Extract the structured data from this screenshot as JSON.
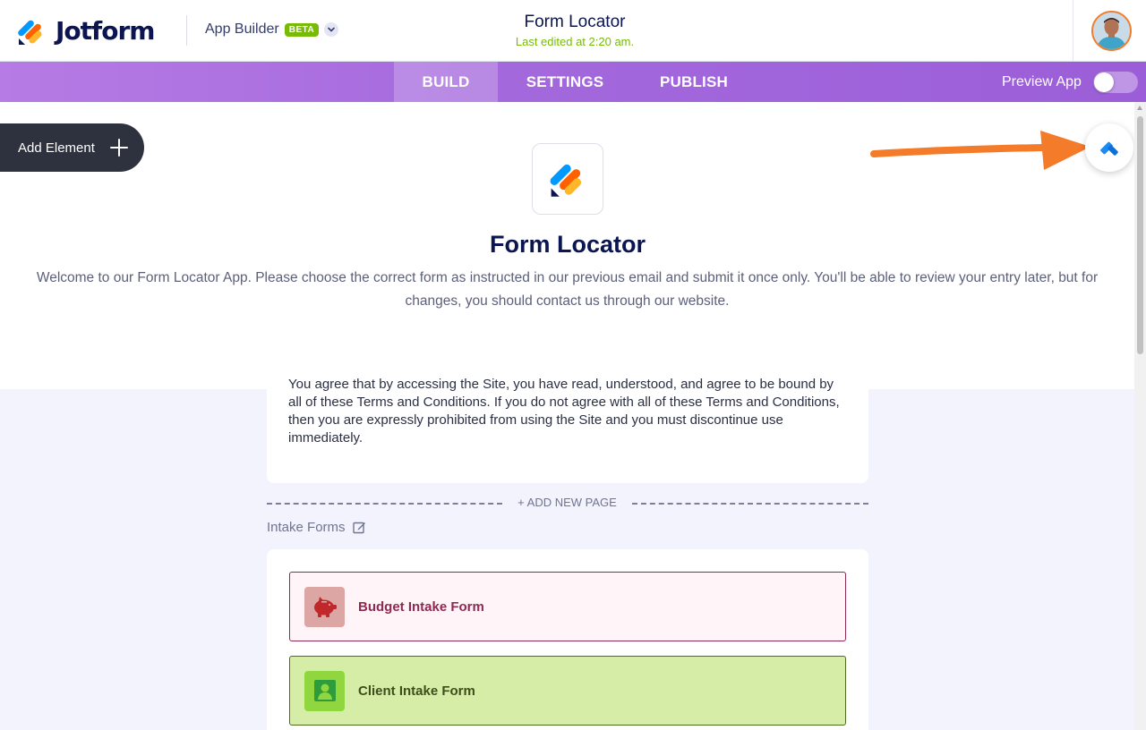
{
  "header": {
    "brand": "Jotform",
    "app_builder_label": "App Builder",
    "beta_badge": "BETA",
    "app_title": "Form Locator",
    "last_edited": "Last edited at 2:20 am."
  },
  "nav": {
    "tabs": [
      {
        "label": "BUILD",
        "active": true
      },
      {
        "label": "SETTINGS",
        "active": false
      },
      {
        "label": "PUBLISH",
        "active": false
      }
    ],
    "preview_label": "Preview App",
    "preview_enabled": false
  },
  "toolbar": {
    "add_element_label": "Add Element"
  },
  "app": {
    "name": "Form Locator",
    "description": "Welcome to our Form Locator App. Please choose the correct form as instructed in our previous email and submit it once only. You'll be able to review your entry later, but for changes, you should contact us through our website."
  },
  "terms": {
    "text": "You agree that by accessing the Site, you have read, understood, and agree to be bound by all of these Terms and Conditions. If you do not agree with all of these Terms and Conditions, then you are expressly prohibited from using the Site and you must discontinue use immediately."
  },
  "add_page_label": "+ ADD NEW PAGE",
  "section": {
    "title": "Intake Forms",
    "forms": [
      {
        "label": "Budget Intake Form",
        "icon": "piggy-bank-icon",
        "color": "#8c2a52"
      },
      {
        "label": "Client Intake Form",
        "icon": "user-icon",
        "color": "#78bb07"
      }
    ]
  },
  "colors": {
    "brand_navy": "#0a1551",
    "accent_purple": "#a468dd",
    "accent_green": "#78bb07",
    "arrow_orange": "#f47b2a"
  }
}
